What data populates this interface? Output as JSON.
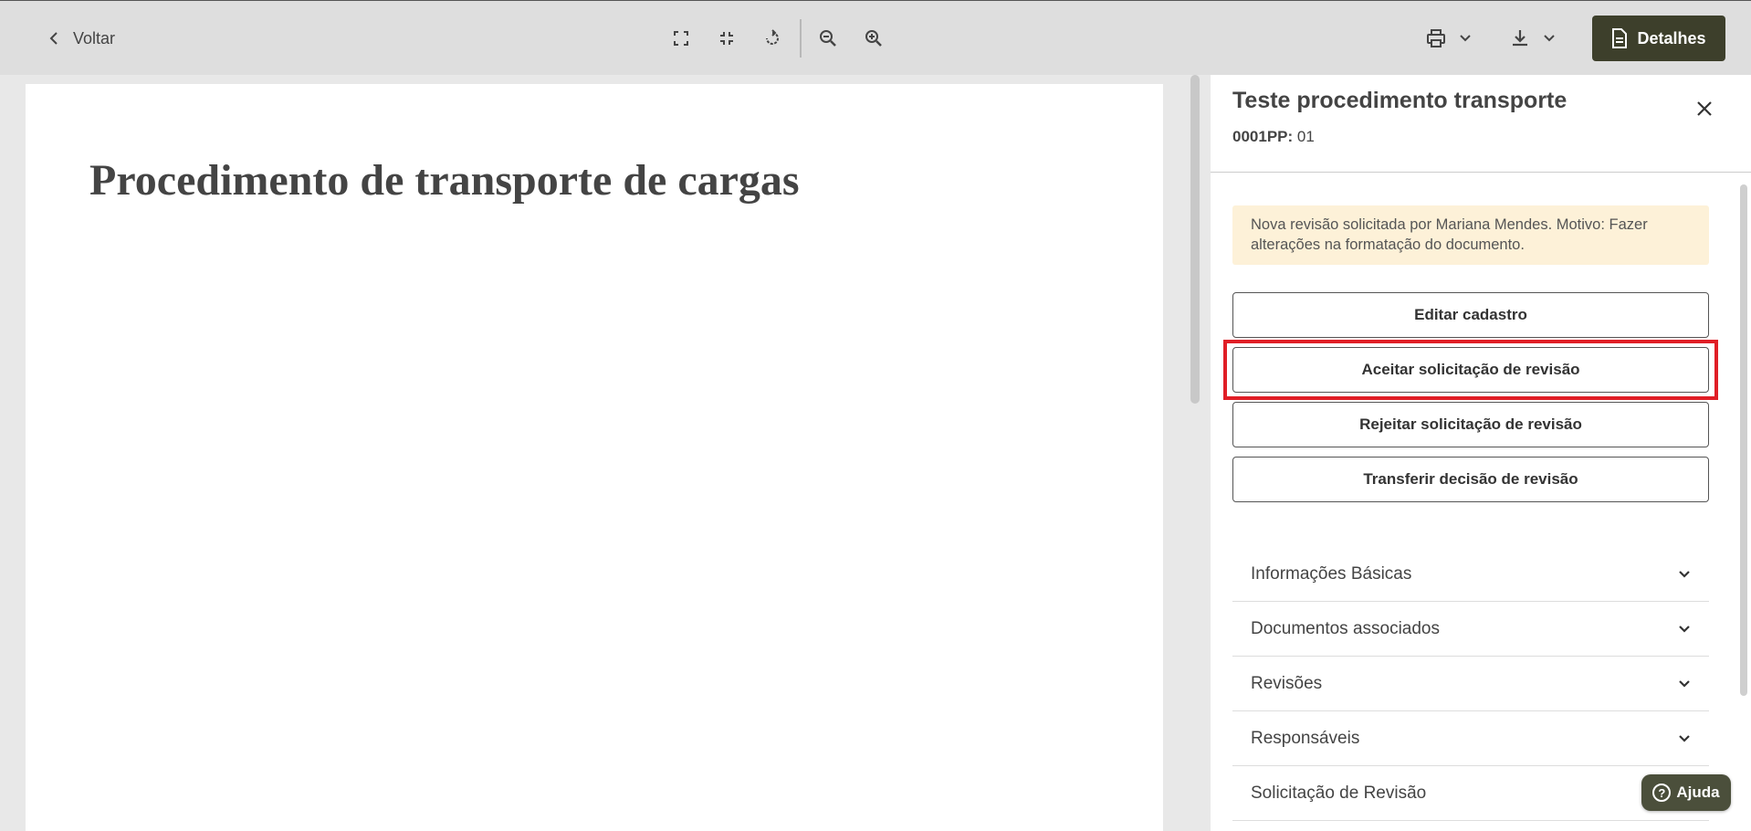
{
  "toolbar": {
    "back_label": "Voltar",
    "details_label": "Detalhes",
    "icons": [
      "fullscreen-icon",
      "exit-fullscreen-icon",
      "rotate-icon",
      "zoom-out-icon",
      "zoom-in-icon",
      "print-icon",
      "download-icon"
    ]
  },
  "document": {
    "title": "Procedimento de transporte de cargas"
  },
  "panel": {
    "title": "Teste procedimento transporte",
    "code_label": "0001PP:",
    "code_value": "01",
    "notice": "Nova revisão solicitada por Mariana Mendes. Motivo: Fazer alterações na formatação do documento.",
    "actions": [
      {
        "label": "Editar cadastro"
      },
      {
        "label": "Aceitar solicitação de revisão"
      },
      {
        "label": "Rejeitar solicitação de revisão"
      },
      {
        "label": "Transferir decisão de revisão"
      }
    ],
    "sections": [
      {
        "label": "Informações Básicas"
      },
      {
        "label": "Documentos associados"
      },
      {
        "label": "Revisões"
      },
      {
        "label": "Responsáveis"
      },
      {
        "label": "Solicitação de Revisão"
      }
    ]
  },
  "help": {
    "label": "Ajuda"
  },
  "colors": {
    "details_button": "#3d3f2b",
    "notice_background": "#fdf1d8",
    "highlight": "#e01e26",
    "help_button": "#4b4f3b"
  }
}
